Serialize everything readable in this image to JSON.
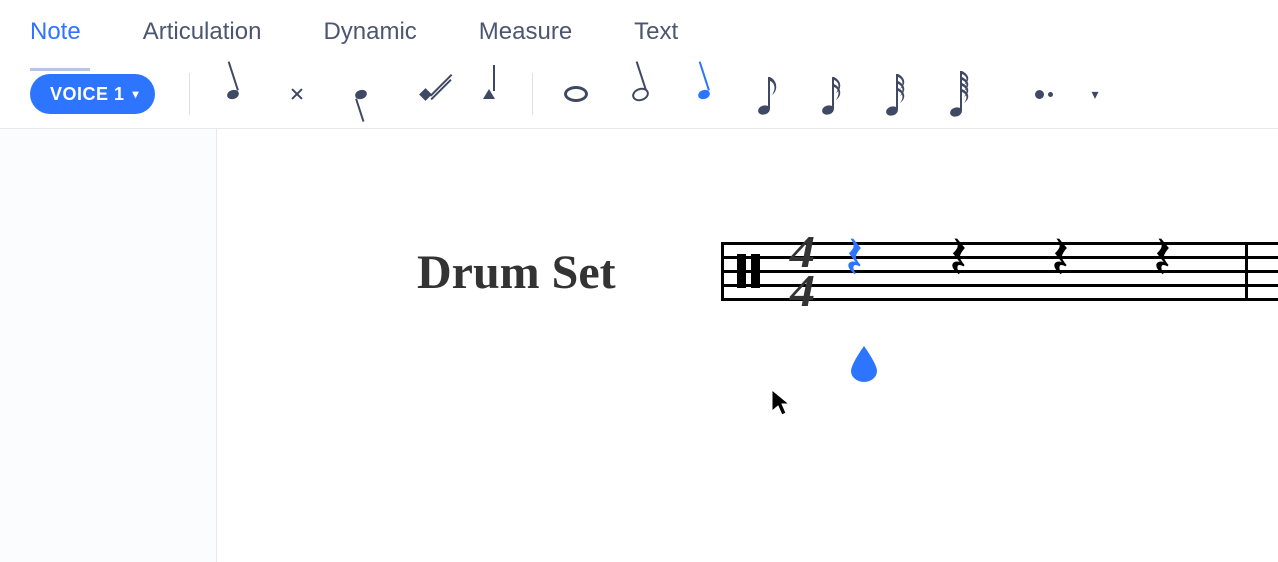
{
  "tabs": {
    "note": "Note",
    "articulation": "Articulation",
    "dynamic": "Dynamic",
    "measure": "Measure",
    "text": "Text",
    "active": "note"
  },
  "toolbar": {
    "voice_label": "VOICE 1",
    "palette_icons": [
      "quarter-note",
      "x-note",
      "dot-stem-note",
      "diamond-note",
      "triangle-note"
    ],
    "duration_icons": [
      "whole-note",
      "half-note",
      "quarter-note-selected",
      "eighth-note",
      "sixteenth-note",
      "thirtysecond-note",
      "sixtyfourth-note"
    ],
    "extra_icons": [
      "dotted-note"
    ]
  },
  "score": {
    "instrument_label": "Drum Set",
    "time_signature": {
      "top": "4",
      "bottom": "4"
    },
    "rests": [
      {
        "position": 1,
        "selected": true
      },
      {
        "position": 2,
        "selected": false
      },
      {
        "position": 3,
        "selected": false
      },
      {
        "position": 4,
        "selected": false
      }
    ]
  },
  "icons": {
    "quarter_rest": "𝄽",
    "whole_note": "𝅝",
    "caret_down": "▾"
  }
}
